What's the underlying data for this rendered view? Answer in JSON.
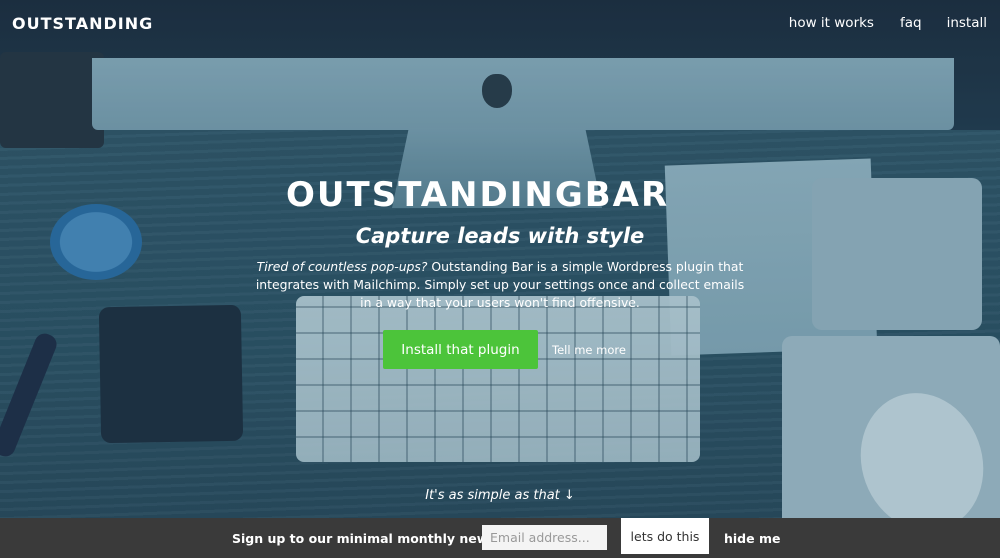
{
  "header": {
    "brand": "OUTSTANDING",
    "nav": {
      "how": "how it works",
      "faq": "faq",
      "install": "install"
    }
  },
  "hero": {
    "logo": "OUTSTANDINGBAR",
    "tagline": "Capture leads with style",
    "intro_italic": "Tired of countless pop-ups?",
    "intro_rest": " Outstanding Bar is a simple Wordpress plugin that integrates with Mailchimp. Simply set up your settings once and collect emails in a way that your users won't find offensive.",
    "install_label": "Install that plugin",
    "more_label": "Tell me more",
    "simple": "It's as simple as that ↓"
  },
  "bar": {
    "text": "Sign up to our minimal monthly newsletter",
    "email_placeholder": "Email address...",
    "submit": "lets do this",
    "hide": "hide me"
  },
  "colors": {
    "cta": "#4cc43a",
    "bar": "#3a3a3a"
  }
}
